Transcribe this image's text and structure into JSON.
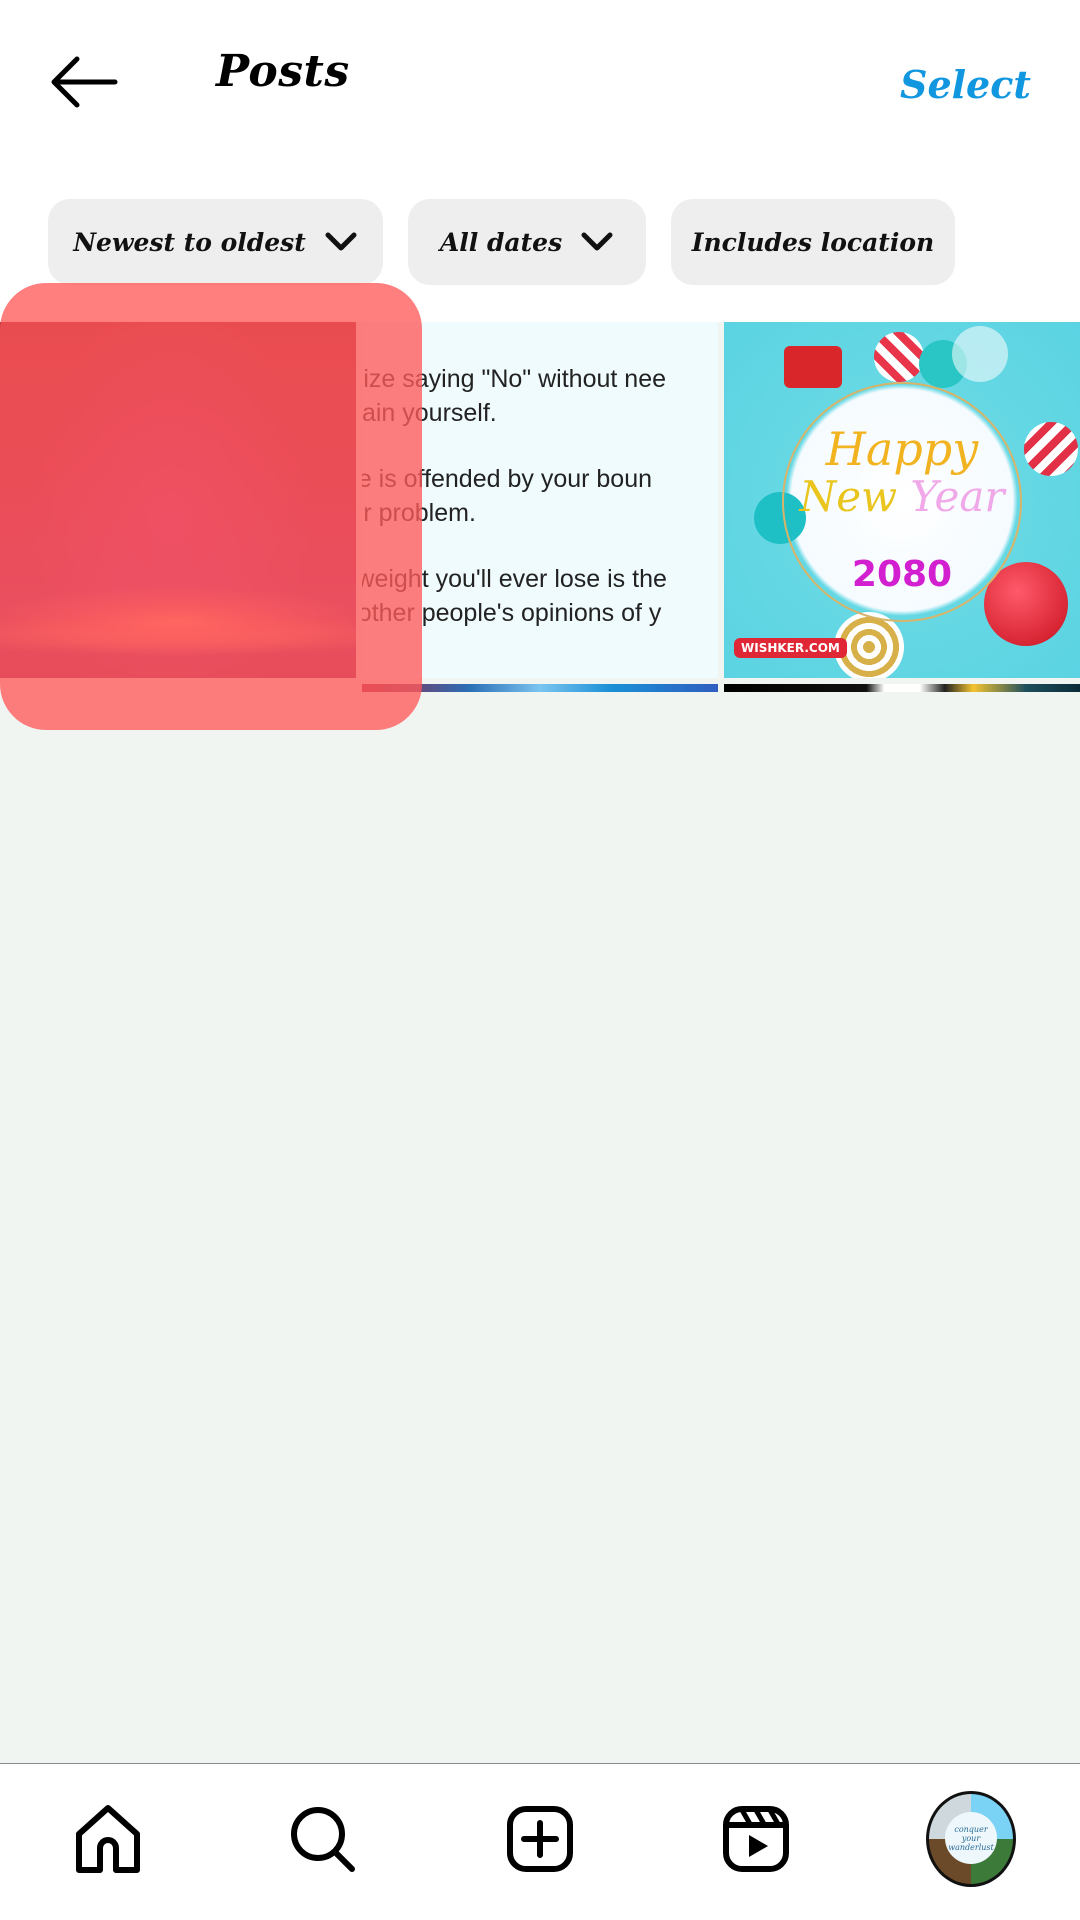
{
  "header": {
    "back_icon": "arrow-left-icon",
    "title": "Posts",
    "select_label": "Select",
    "select_color": "#1197e0"
  },
  "filters": [
    {
      "label": "Newest to oldest",
      "has_dropdown": true,
      "icon": "chevron-down-icon"
    },
    {
      "label": "All dates",
      "has_dropdown": true,
      "icon": "chevron-down-icon"
    },
    {
      "label": "Includes location",
      "has_dropdown": false
    }
  ],
  "posts": [
    {
      "type": "image",
      "description": "Magenta cosmic horizon glow",
      "highlighted": true
    },
    {
      "type": "text-image",
      "lines": [
        "nalize saying \"No\" without nee",
        "xplain yourself.",
        "one is offended by your boun",
        "heir problem.",
        "st weight you'll ever lose is the",
        "of other people's opinions of y"
      ]
    },
    {
      "type": "image",
      "description": "Happy New Year greeting",
      "text_happy": "Happy",
      "text_new": "New",
      "text_year": "Year",
      "year": "2080",
      "watermark": "WISHKER.COM"
    }
  ],
  "highlight": {
    "color": "#ff5a5a",
    "target": "post-1"
  },
  "bottom_nav": [
    {
      "name": "home",
      "icon": "home-icon"
    },
    {
      "name": "search",
      "icon": "search-icon"
    },
    {
      "name": "create",
      "icon": "plus-square-icon"
    },
    {
      "name": "reels",
      "icon": "reels-icon"
    },
    {
      "name": "profile",
      "icon": "avatar",
      "avatar_text": [
        "conquer",
        "your",
        "wanderlust"
      ]
    }
  ]
}
